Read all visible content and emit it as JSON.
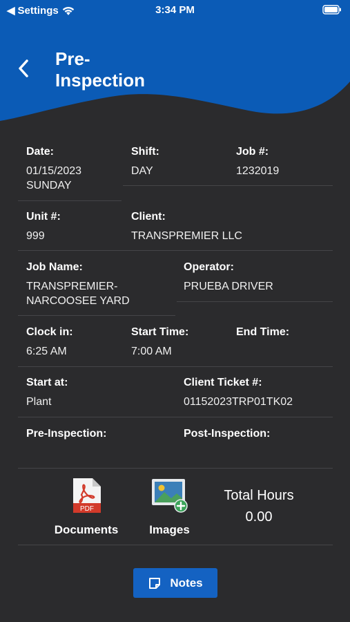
{
  "status_bar": {
    "back_app": "Settings",
    "time": "3:34 PM"
  },
  "header": {
    "title": "Pre-\nInspection"
  },
  "fields": {
    "date": {
      "label": "Date:",
      "value": "01/15/2023\nSUNDAY"
    },
    "shift": {
      "label": "Shift:",
      "value": "DAY"
    },
    "job_number": {
      "label": "Job #:",
      "value": "1232019"
    },
    "unit_number": {
      "label": "Unit #:",
      "value": "999"
    },
    "client": {
      "label": "Client:",
      "value": "TRANSPREMIER LLC"
    },
    "job_name": {
      "label": "Job Name:",
      "value": "TRANSPREMIER-\nNARCOOSEE YARD"
    },
    "operator": {
      "label": "Operator:",
      "value": "PRUEBA DRIVER"
    },
    "clock_in": {
      "label": "Clock in:",
      "value": "6:25 AM"
    },
    "start_time": {
      "label": "Start Time:",
      "value": "7:00 AM"
    },
    "end_time": {
      "label": "End Time:",
      "value": ""
    },
    "start_at": {
      "label": "Start at:",
      "value": "Plant"
    },
    "client_ticket": {
      "label": "Client Ticket #:",
      "value": "01152023TRP01TK02"
    },
    "pre_inspection": {
      "label": "Pre-Inspection:",
      "value": ""
    },
    "post_inspection": {
      "label": "Post-Inspection:",
      "value": ""
    }
  },
  "actions": {
    "documents_label": "Documents",
    "documents_icon_text": "PDF",
    "images_label": "Images",
    "total_hours_label": "Total Hours",
    "total_hours_value": "0.00",
    "notes_label": "Notes"
  },
  "colors": {
    "header_blue": "#0b5bb6",
    "background": "#2b2b2d",
    "button_blue": "#1462c2",
    "pdf_red": "#d23a2a",
    "add_green": "#3ca45a"
  },
  "icons": [
    "wifi-icon",
    "battery-icon",
    "back-chevron-icon",
    "pdf-icon",
    "image-add-icon",
    "note-icon"
  ]
}
